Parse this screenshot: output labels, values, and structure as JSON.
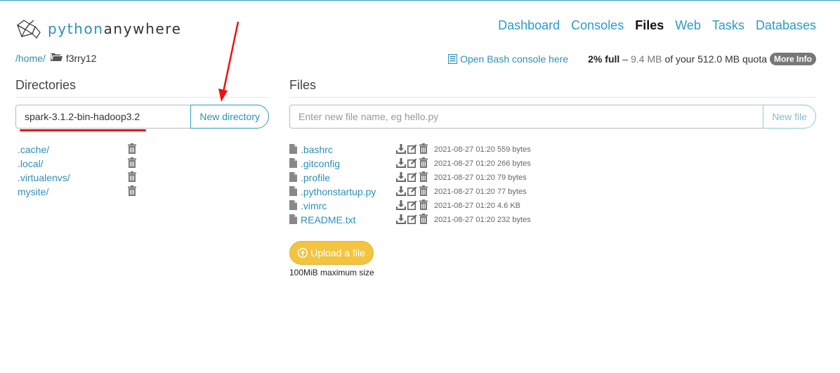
{
  "brand": {
    "part1": "python",
    "part2": "anywhere"
  },
  "nav": [
    "Dashboard",
    "Consoles",
    "Files",
    "Web",
    "Tasks",
    "Databases"
  ],
  "nav_active": "Files",
  "breadcrumb": {
    "home": "/home/",
    "current": "f3rry12"
  },
  "bash_link": "Open Bash console here",
  "quota": {
    "percent": "2% full",
    "dash": "–",
    "used": "9.4 MB",
    "rest": "of your 512.0 MB quota",
    "more_info": "More Info"
  },
  "directories": {
    "title": "Directories",
    "input_value": "spark-3.1.2-bin-hadoop3.2",
    "button": "New directory",
    "items": [
      ".cache/",
      ".local/",
      ".virtualenvs/",
      "mysite/"
    ]
  },
  "files": {
    "title": "Files",
    "placeholder": "Enter new file name, eg hello.py",
    "button": "New file",
    "items": [
      {
        "name": ".bashrc",
        "date": "2021-08-27 01:20",
        "size": "559 bytes"
      },
      {
        "name": ".gitconfig",
        "date": "2021-08-27 01:20",
        "size": "266 bytes"
      },
      {
        "name": ".profile",
        "date": "2021-08-27 01:20",
        "size": "79 bytes"
      },
      {
        "name": ".pythonstartup.py",
        "date": "2021-08-27 01:20",
        "size": "77 bytes"
      },
      {
        "name": ".vimrc",
        "date": "2021-08-27 01:20",
        "size": "4.6 KB"
      },
      {
        "name": "README.txt",
        "date": "2021-08-27 01:20",
        "size": "232 bytes"
      }
    ]
  },
  "upload": {
    "label": "Upload a file",
    "note": "100MiB maximum size"
  },
  "colors": {
    "link": "#2d8fb8",
    "upload": "#f2c440",
    "annotation": "#e11111"
  },
  "icons": [
    "logo-icon",
    "folder-icon",
    "console-icon",
    "trash-icon",
    "file-icon",
    "download-icon",
    "edit-icon",
    "upload-icon"
  ]
}
